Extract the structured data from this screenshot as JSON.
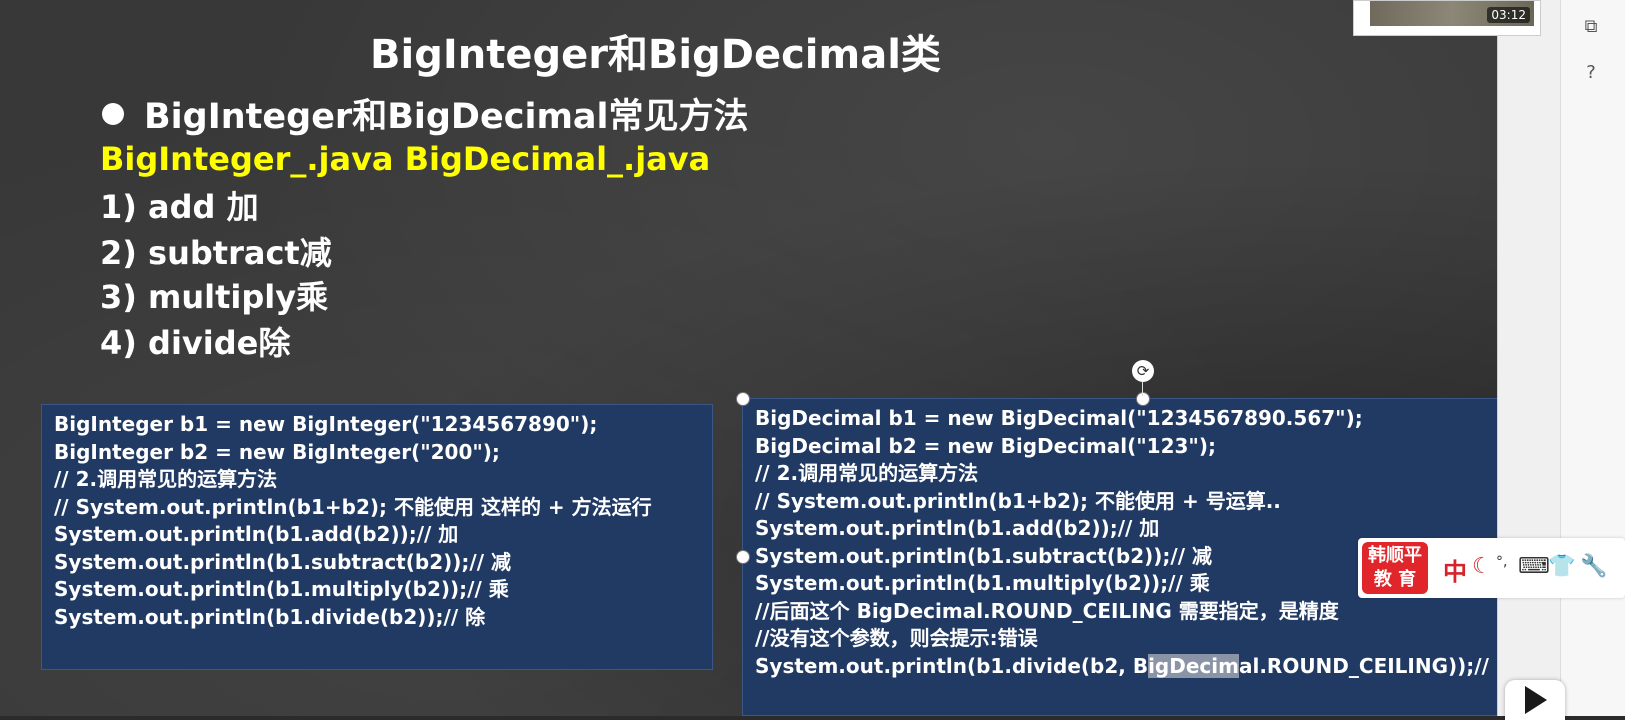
{
  "slide": {
    "title": "BigInteger和BigDecimal类",
    "bullet_heading": "BigInteger和BigDecimal常见方法",
    "files_line": "BigInteger_.java BigDecimal_.java",
    "methods": [
      "1) add 加",
      "2) subtract减",
      "3) multiply乘",
      "4) divide除"
    ]
  },
  "code_left": {
    "lines": [
      "BigInteger b1 = new BigInteger(\"1234567890\");",
      "BigInteger b2 = new BigInteger(\"200\");",
      "// 2.调用常见的运算方法",
      "// System.out.println(b1+b2); 不能使用 这样的 + 方法运行",
      "System.out.println(b1.add(b2));// 加",
      "System.out.println(b1.subtract(b2));// 减",
      "System.out.println(b1.multiply(b2));// 乘",
      "System.out.println(b1.divide(b2));// 除"
    ]
  },
  "code_right": {
    "lines": [
      "BigDecimal b1 = new BigDecimal(\"1234567890.567\");",
      "BigDecimal b2 = new BigDecimal(\"123\");",
      "// 2.调用常见的运算方法",
      "// System.out.println(b1+b2); 不能使用 + 号运算..",
      "System.out.println(b1.add(b2));// 加",
      "System.out.println(b1.subtract(b2));// 减",
      "System.out.println(b1.multiply(b2));// 乘",
      "//后面这个 BigDecimal.ROUND_CEILING 需要指定，是精度",
      "//没有这个参数，则会提示:错误"
    ],
    "last_line_before": "System.out.println(b1.divide(b2, B",
    "last_line_selected": "igDecim",
    "last_line_after": "al.ROUND_CEILING));// 除"
  },
  "video": {
    "timestamp": "03:12"
  },
  "ime": {
    "logo_top": "韩顺平",
    "logo_bottom": "教 育",
    "lang": "中"
  },
  "icons": {
    "side_top": "window-switch-icon",
    "side_help": "help-icon",
    "rotate": "rotate-icon",
    "moon": "moon-icon",
    "keyboard": "keyboard-icon",
    "shirt": "shirt-icon",
    "wrench": "wrench-icon",
    "play": "play-icon"
  }
}
